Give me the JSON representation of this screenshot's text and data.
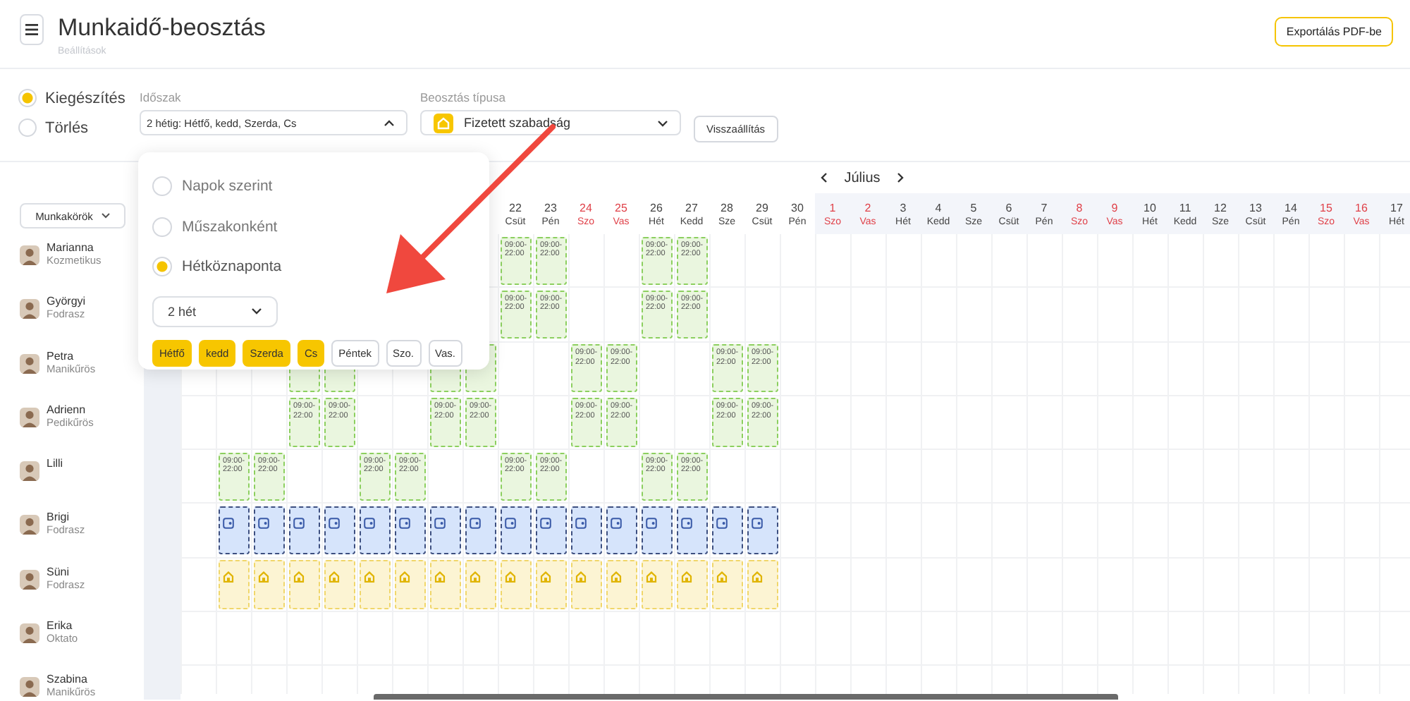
{
  "header": {
    "title": "Munkaidő-beosztás",
    "subtitle": "Beállítások",
    "export_button": "Exportálás PDF-be"
  },
  "mode": [
    {
      "label": "Kiegészítés",
      "selected": true
    },
    {
      "label": "Törlés",
      "selected": false
    }
  ],
  "period": {
    "label": "Időszak",
    "value": "2 hétig: Hétfő, kedd, Szerda, Cs",
    "expanded": true
  },
  "schedule_type": {
    "label": "Beosztás típusa",
    "value": "Fizetett szabadság"
  },
  "reset_button": "Visszaállítás",
  "period_popup": {
    "options": [
      {
        "label": "Napok szerint",
        "selected": false
      },
      {
        "label": "Műszakonként",
        "selected": false
      },
      {
        "label": "Hétköznaponta",
        "selected": true
      }
    ],
    "weeks": "2 hét",
    "days": [
      {
        "label": "Hétfő",
        "selected": true
      },
      {
        "label": "kedd",
        "selected": true
      },
      {
        "label": "Szerda",
        "selected": true
      },
      {
        "label": "Cs",
        "selected": true
      },
      {
        "label": "Péntek",
        "selected": false
      },
      {
        "label": "Szo.",
        "selected": false
      },
      {
        "label": "Vas.",
        "selected": false
      }
    ]
  },
  "roles_filter": "Munkakörök",
  "month": "Július",
  "days": [
    {
      "num": "22",
      "name": "Csüt",
      "weekend": false,
      "in_month": false
    },
    {
      "num": "23",
      "name": "Pén",
      "weekend": false,
      "in_month": false
    },
    {
      "num": "24",
      "name": "Szo",
      "weekend": true,
      "in_month": false
    },
    {
      "num": "25",
      "name": "Vas",
      "weekend": true,
      "in_month": false
    },
    {
      "num": "26",
      "name": "Hét",
      "weekend": false,
      "in_month": false
    },
    {
      "num": "27",
      "name": "Kedd",
      "weekend": false,
      "in_month": false
    },
    {
      "num": "28",
      "name": "Sze",
      "weekend": false,
      "in_month": false
    },
    {
      "num": "29",
      "name": "Csüt",
      "weekend": false,
      "in_month": false
    },
    {
      "num": "30",
      "name": "Pén",
      "weekend": false,
      "in_month": false
    },
    {
      "num": "1",
      "name": "Szo",
      "weekend": true,
      "in_month": true
    },
    {
      "num": "2",
      "name": "Vas",
      "weekend": true,
      "in_month": true
    },
    {
      "num": "3",
      "name": "Hét",
      "weekend": false,
      "in_month": true
    },
    {
      "num": "4",
      "name": "Kedd",
      "weekend": false,
      "in_month": true
    },
    {
      "num": "5",
      "name": "Sze",
      "weekend": false,
      "in_month": true
    },
    {
      "num": "6",
      "name": "Csüt",
      "weekend": false,
      "in_month": true
    },
    {
      "num": "7",
      "name": "Pén",
      "weekend": false,
      "in_month": true
    },
    {
      "num": "8",
      "name": "Szo",
      "weekend": true,
      "in_month": true
    },
    {
      "num": "9",
      "name": "Vas",
      "weekend": true,
      "in_month": true
    },
    {
      "num": "10",
      "name": "Hét",
      "weekend": false,
      "in_month": true
    },
    {
      "num": "11",
      "name": "Kedd",
      "weekend": false,
      "in_month": true
    },
    {
      "num": "12",
      "name": "Sze",
      "weekend": false,
      "in_month": true
    },
    {
      "num": "13",
      "name": "Csüt",
      "weekend": false,
      "in_month": true
    },
    {
      "num": "14",
      "name": "Pén",
      "weekend": false,
      "in_month": true
    },
    {
      "num": "15",
      "name": "Szo",
      "weekend": true,
      "in_month": true
    },
    {
      "num": "16",
      "name": "Vas",
      "weekend": true,
      "in_month": true
    },
    {
      "num": "17",
      "name": "Hét",
      "weekend": false,
      "in_month": true
    }
  ],
  "employees": [
    {
      "name": "Marianna",
      "role": "Kozmetikus",
      "cells": [
        {
          "kind": "none"
        },
        {
          "kind": "none"
        },
        {
          "kind": "none"
        },
        {
          "kind": "none"
        },
        {
          "kind": "none"
        },
        {
          "kind": "none"
        },
        {
          "kind": "none"
        },
        {
          "kind": "none"
        },
        {
          "kind": "none"
        },
        {
          "kind": "work",
          "time": "09:00-22:00"
        },
        {
          "kind": "work",
          "time": "09:00-22:00"
        },
        {
          "kind": "none"
        },
        {
          "kind": "none"
        },
        {
          "kind": "work",
          "time": "09:00-22:00"
        },
        {
          "kind": "work",
          "time": "09:00-22:00"
        }
      ]
    },
    {
      "name": "Györgyi",
      "role": "Fodrasz",
      "cells": [
        {
          "kind": "none"
        },
        {
          "kind": "none"
        },
        {
          "kind": "none"
        },
        {
          "kind": "none"
        },
        {
          "kind": "none"
        },
        {
          "kind": "none"
        },
        {
          "kind": "none"
        },
        {
          "kind": "none"
        },
        {
          "kind": "none"
        },
        {
          "kind": "work",
          "time": "09:00-22:00"
        },
        {
          "kind": "work",
          "time": "09:00-22:00"
        },
        {
          "kind": "none"
        },
        {
          "kind": "none"
        },
        {
          "kind": "work",
          "time": "09:00-22:00"
        },
        {
          "kind": "work",
          "time": "09:00-22:00"
        }
      ]
    },
    {
      "name": "Petra",
      "role": "Manikűrös",
      "cells": [
        {
          "kind": "none"
        },
        {
          "kind": "none"
        },
        {
          "kind": "none"
        },
        {
          "kind": "work"
        },
        {
          "kind": "work"
        },
        {
          "kind": "none"
        },
        {
          "kind": "none"
        },
        {
          "kind": "work"
        },
        {
          "kind": "work"
        },
        {
          "kind": "none"
        },
        {
          "kind": "none"
        },
        {
          "kind": "work",
          "time": "09:00-22:00"
        },
        {
          "kind": "work",
          "time": "09:00-22:00"
        },
        {
          "kind": "none"
        },
        {
          "kind": "none"
        },
        {
          "kind": "work",
          "time": "09:00-22:00"
        },
        {
          "kind": "work",
          "time": "09:00-22:00"
        }
      ]
    },
    {
      "name": "Adrienn",
      "role": "Pedikűrös",
      "cells": [
        {
          "kind": "none"
        },
        {
          "kind": "none"
        },
        {
          "kind": "none"
        },
        {
          "kind": "work",
          "time": "09:00-22:00"
        },
        {
          "kind": "work",
          "time": "09:00-22:00"
        },
        {
          "kind": "none"
        },
        {
          "kind": "none"
        },
        {
          "kind": "work",
          "time": "09:00-22:00"
        },
        {
          "kind": "work",
          "time": "09:00-22:00"
        },
        {
          "kind": "none"
        },
        {
          "kind": "none"
        },
        {
          "kind": "work",
          "time": "09:00-22:00"
        },
        {
          "kind": "work",
          "time": "09:00-22:00"
        },
        {
          "kind": "none"
        },
        {
          "kind": "none"
        },
        {
          "kind": "work",
          "time": "09:00-22:00"
        },
        {
          "kind": "work",
          "time": "09:00-22:00"
        }
      ]
    },
    {
      "name": "Lilli",
      "cells": [
        {
          "kind": "none"
        },
        {
          "kind": "work",
          "time": "09:00-22:00"
        },
        {
          "kind": "work",
          "time": "09:00-22:00"
        },
        {
          "kind": "none"
        },
        {
          "kind": "none"
        },
        {
          "kind": "work",
          "time": "09:00-22:00"
        },
        {
          "kind": "work",
          "time": "09:00-22:00"
        },
        {
          "kind": "none"
        },
        {
          "kind": "none"
        },
        {
          "kind": "work",
          "time": "09:00-22:00"
        },
        {
          "kind": "work",
          "time": "09:00-22:00"
        },
        {
          "kind": "none"
        },
        {
          "kind": "none"
        },
        {
          "kind": "work",
          "time": "09:00-22:00"
        },
        {
          "kind": "work",
          "time": "09:00-22:00"
        }
      ]
    },
    {
      "name": "Brigi",
      "role": "Fodrasz",
      "cells": [
        {
          "kind": "none"
        },
        {
          "kind": "wallet"
        },
        {
          "kind": "wallet"
        },
        {
          "kind": "wallet"
        },
        {
          "kind": "wallet"
        },
        {
          "kind": "wallet"
        },
        {
          "kind": "wallet"
        },
        {
          "kind": "wallet"
        },
        {
          "kind": "wallet"
        },
        {
          "kind": "wallet"
        },
        {
          "kind": "wallet"
        },
        {
          "kind": "wallet"
        },
        {
          "kind": "wallet"
        },
        {
          "kind": "wallet"
        },
        {
          "kind": "wallet"
        },
        {
          "kind": "wallet"
        },
        {
          "kind": "wallet"
        }
      ]
    },
    {
      "name": "Süni",
      "role": "Fodrasz",
      "cells": [
        {
          "kind": "none"
        },
        {
          "kind": "leave"
        },
        {
          "kind": "leave"
        },
        {
          "kind": "leave"
        },
        {
          "kind": "leave"
        },
        {
          "kind": "leave"
        },
        {
          "kind": "leave"
        },
        {
          "kind": "leave"
        },
        {
          "kind": "leave"
        },
        {
          "kind": "leave"
        },
        {
          "kind": "leave"
        },
        {
          "kind": "leave"
        },
        {
          "kind": "leave"
        },
        {
          "kind": "leave"
        },
        {
          "kind": "leave"
        },
        {
          "kind": "leave"
        },
        {
          "kind": "leave"
        }
      ]
    },
    {
      "name": "Erika",
      "role": "Oktato"
    },
    {
      "name": "Szabina",
      "role": "Manikűrös"
    }
  ]
}
